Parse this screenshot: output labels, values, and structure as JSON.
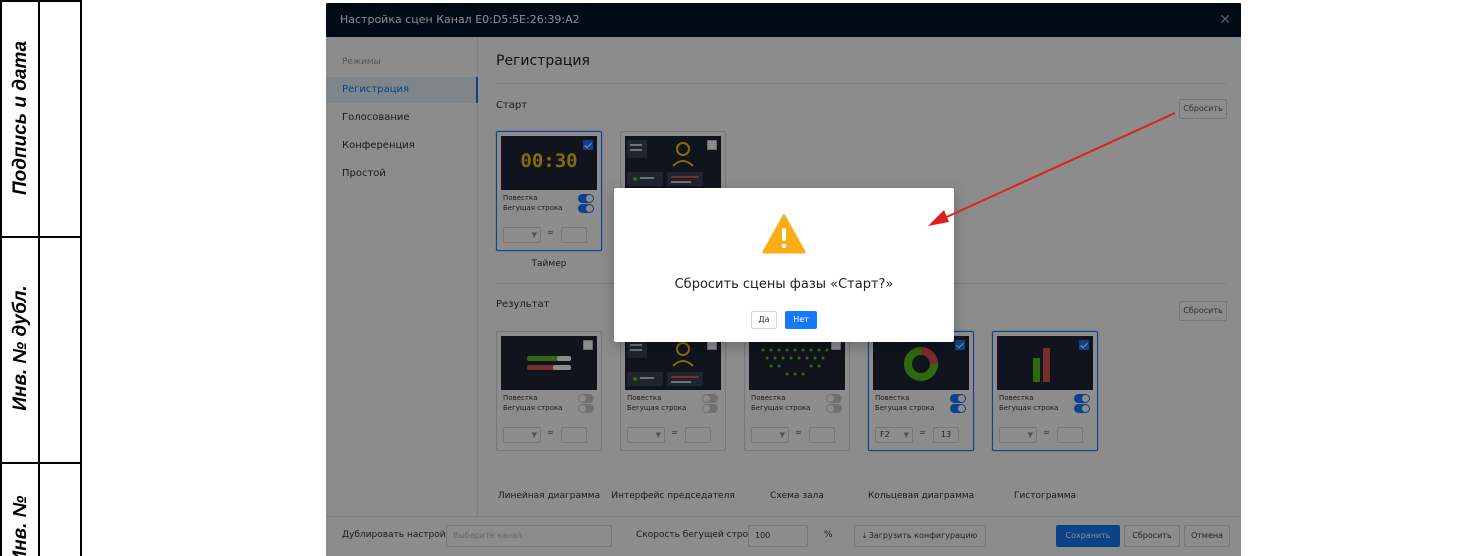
{
  "stamp": {
    "label_signature_date": "Подпись и дата",
    "label_dup_inv": "Инв. № дубл.",
    "label_inv_no": "Инв. №"
  },
  "window": {
    "title": "Настройка сцен Канал E0:D5:5E:26:39:A2",
    "close_icon": "close-icon"
  },
  "sidebar": {
    "heading": "Режимы",
    "items": [
      {
        "label": "Регистрация",
        "active": true
      },
      {
        "label": "Голосование"
      },
      {
        "label": "Конференция"
      },
      {
        "label": "Простой"
      }
    ]
  },
  "main": {
    "title": "Регистрация",
    "start": {
      "label": "Старт",
      "reset_label": "Сбросить",
      "timer_value": "00:30",
      "timer_caption": "Таймер",
      "agenda_label": "Повестка",
      "ticker_label": "Бегущая строка"
    },
    "result": {
      "label": "Результат",
      "reset_label": "Сбросить",
      "cards": [
        {
          "caption": "Линейная диаграмма",
          "agenda": "Повестка",
          "ticker": "Бегущая строка"
        },
        {
          "caption": "Интерфейс председателя",
          "agenda": "Повестка",
          "ticker": "Бегущая строка"
        },
        {
          "caption": "Схема зала",
          "agenda": "Повестка",
          "ticker": "Бегущая строка"
        },
        {
          "caption": "Кольцевая диаграмма",
          "agenda": "Повестка",
          "ticker": "Бегущая строка",
          "select_value": "F2",
          "number_value": "13"
        },
        {
          "caption": "Гистограмма",
          "agenda": "Повестка",
          "ticker": "Бегущая строка"
        }
      ]
    }
  },
  "bottom": {
    "duplicate_label": "Дублировать настройки:",
    "channel_placeholder": "Выберите канал",
    "speed_label": "Скорость бегущей строки:",
    "speed_value": "100",
    "speed_unit": "%",
    "upload_label": "Загрузить конфигурацию",
    "save_label": "Сохранить",
    "reset_label": "Сбросить",
    "cancel_label": "Отмена"
  },
  "dialog": {
    "message": "Сбросить сцены фазы «Старт?»",
    "yes_label": "Да",
    "no_label": "Нет",
    "icon": "warning-icon"
  },
  "colors": {
    "accent": "#1677ff",
    "titlebar": "#001529",
    "warning": "#faad14",
    "timer_text": "#f0c419",
    "annotation_arrow": "#e02020"
  }
}
